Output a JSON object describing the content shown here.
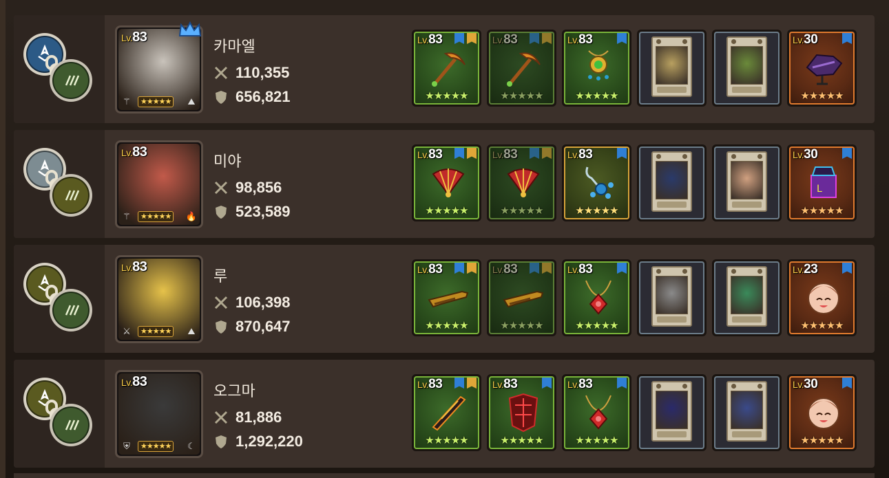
{
  "rows": [
    {
      "name": "카마엘",
      "level_prefix": "Lv.",
      "level": "83",
      "hero_stars": "★★★★★",
      "attack": "110,355",
      "defense": "656,821",
      "crown": true,
      "badge_a_color": "#2c5a86",
      "badge_b_color": "#3f5a2e",
      "art_color": "#c9c3bb",
      "icon_left": "⚚",
      "icon_right": "⛰",
      "slots": [
        {
          "type": "green",
          "lv": "83",
          "flags": [
            "blue",
            "gold"
          ],
          "stars": "★★★★★",
          "item": "pickaxe-orange"
        },
        {
          "type": "green dim",
          "lv": "83",
          "flags": [
            "blue",
            "gold"
          ],
          "stars": "★★★★★",
          "item": "pickaxe-orange"
        },
        {
          "type": "green",
          "lv": "83",
          "flags": [
            "blue"
          ],
          "stars": "★★★★★",
          "item": "amulet-gold"
        },
        {
          "type": "card",
          "card_color": "#b8a060"
        },
        {
          "type": "card",
          "card_color": "#6a8a3a"
        },
        {
          "type": "orange",
          "lv": "30",
          "flags": [
            "blue"
          ],
          "stars": "★★★★★",
          "item": "purple-costume"
        }
      ]
    },
    {
      "name": "미야",
      "level_prefix": "Lv.",
      "level": "83",
      "hero_stars": "★★★★★",
      "attack": "98,856",
      "defense": "523,589",
      "crown": false,
      "badge_a_color": "#7d8c92",
      "badge_b_color": "#5a5a20",
      "art_color": "#c25a4a",
      "icon_left": "⚚",
      "icon_right": "🔥",
      "slots": [
        {
          "type": "green",
          "lv": "83",
          "flags": [
            "blue",
            "gold"
          ],
          "stars": "★★★★★",
          "item": "fan-red"
        },
        {
          "type": "green dim",
          "lv": "83",
          "flags": [
            "blue",
            "gold"
          ],
          "stars": "★★★★★",
          "item": "fan-red"
        },
        {
          "type": "gold",
          "lv": "83",
          "flags": [
            "blue"
          ],
          "stars": "★★★★★",
          "item": "bead-blue"
        },
        {
          "type": "card",
          "card_color": "#2a3a6a"
        },
        {
          "type": "card",
          "card_color": "#d0a080"
        },
        {
          "type": "orange",
          "lv": "30",
          "flags": [
            "blue"
          ],
          "stars": "★★★★★",
          "item": "neon-box"
        }
      ]
    },
    {
      "name": "루",
      "level_prefix": "Lv.",
      "level": "83",
      "hero_stars": "★★★★★",
      "attack": "106,398",
      "defense": "870,647",
      "crown": false,
      "badge_a_color": "#5a5a20",
      "badge_b_color": "#3f5a2e",
      "art_color": "#e6c24a",
      "icon_left": "⚔",
      "icon_right": "⛰",
      "slots": [
        {
          "type": "green",
          "lv": "83",
          "flags": [
            "blue",
            "gold"
          ],
          "stars": "★★★★★",
          "item": "rifle-gold"
        },
        {
          "type": "green dim",
          "lv": "83",
          "flags": [
            "blue",
            "gold"
          ],
          "stars": "★★★★★",
          "item": "rifle-gold"
        },
        {
          "type": "green",
          "lv": "83",
          "flags": [
            "blue"
          ],
          "stars": "★★★★★",
          "item": "amulet-red"
        },
        {
          "type": "card",
          "card_color": "#8a8a8a"
        },
        {
          "type": "card",
          "card_color": "#3a8a5a"
        },
        {
          "type": "orange",
          "lv": "23",
          "flags": [
            "blue"
          ],
          "stars": "★★★★★",
          "item": "face-costume"
        }
      ]
    },
    {
      "name": "오그마",
      "level_prefix": "Lv.",
      "level": "83",
      "hero_stars": "★★★★★",
      "attack": "81,886",
      "defense": "1,292,220",
      "crown": false,
      "badge_a_color": "#5a5a20",
      "badge_b_color": "#3f5a2e",
      "art_color": "#3a3a3a",
      "icon_left": "⛨",
      "icon_right": "☾",
      "slots": [
        {
          "type": "green",
          "lv": "83",
          "flags": [
            "blue",
            "gold"
          ],
          "stars": "★★★★★",
          "item": "blade-fire"
        },
        {
          "type": "green",
          "lv": "83",
          "flags": [
            "blue"
          ],
          "stars": "★★★★★",
          "item": "armor-red"
        },
        {
          "type": "green",
          "lv": "83",
          "flags": [
            "blue"
          ],
          "stars": "★★★★★",
          "item": "amulet-red"
        },
        {
          "type": "card",
          "card_color": "#2a2a6a"
        },
        {
          "type": "card",
          "card_color": "#3a4a8a"
        },
        {
          "type": "orange",
          "lv": "30",
          "flags": [
            "blue"
          ],
          "stars": "★★★★★",
          "item": "face-costume"
        }
      ]
    }
  ]
}
